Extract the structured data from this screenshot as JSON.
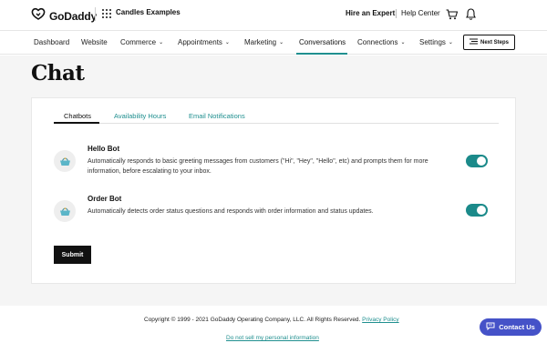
{
  "header": {
    "logo_text": "GoDaddy",
    "site_name": "Candles Examples",
    "hire_expert": "Hire an Expert",
    "help_center": "Help Center"
  },
  "nav": {
    "items": [
      {
        "label": "Dashboard",
        "has_dropdown": false
      },
      {
        "label": "Website",
        "has_dropdown": false
      },
      {
        "label": "Commerce",
        "has_dropdown": true
      },
      {
        "label": "Appointments",
        "has_dropdown": true
      },
      {
        "label": "Marketing",
        "has_dropdown": true
      },
      {
        "label": "Conversations",
        "has_dropdown": false,
        "active": true
      },
      {
        "label": "Connections",
        "has_dropdown": true
      },
      {
        "label": "Settings",
        "has_dropdown": true
      }
    ],
    "next_steps": "Next Steps"
  },
  "page": {
    "title": "Chat",
    "tabs": [
      {
        "label": "Chatbots",
        "active": true
      },
      {
        "label": "Availability Hours",
        "active": false
      },
      {
        "label": "Email Notifications",
        "active": false
      }
    ],
    "bots": [
      {
        "name": "Hello Bot",
        "description": "Automatically responds to basic greeting messages from customers (\"Hi\", \"Hey\", \"Hello\", etc) and prompts them for more information, before escalating to your inbox.",
        "enabled": true
      },
      {
        "name": "Order Bot",
        "description": "Automatically detects order status questions and responds with order information and status updates.",
        "enabled": true
      }
    ],
    "submit_label": "Submit"
  },
  "footer": {
    "copyright": "Copyright © 1999 - 2021 GoDaddy Operating Company, LLC. All Rights Reserved.",
    "privacy_policy": "Privacy Policy",
    "do_not_sell": "Do not sell my personal information"
  },
  "contact_us": "Contact Us",
  "colors": {
    "accent": "#1f8f8f",
    "toggle_on": "#1b8a8a",
    "contact_button": "#4552c8",
    "page_bg": "#f5f5f5"
  }
}
